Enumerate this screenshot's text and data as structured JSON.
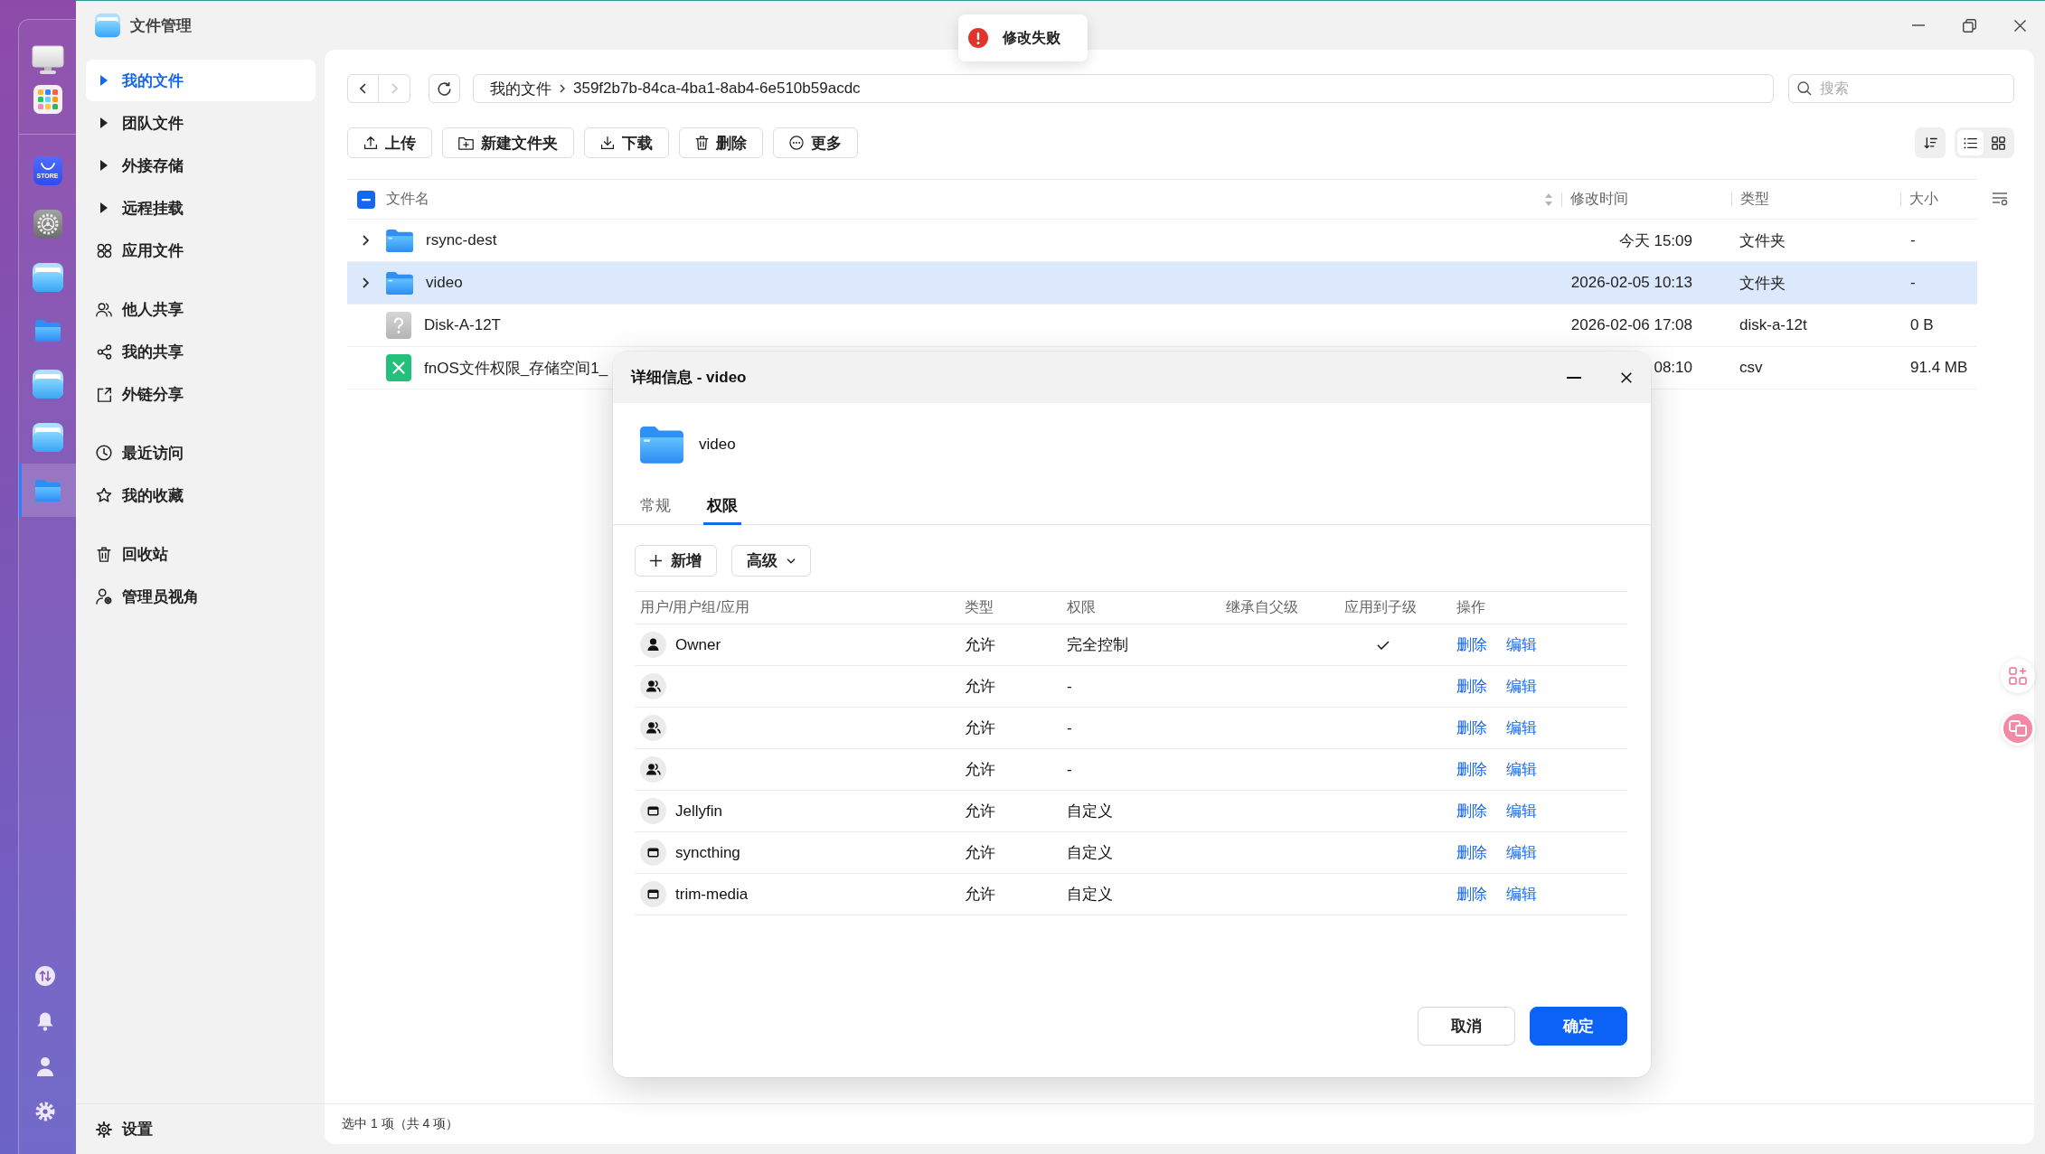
{
  "dock": {
    "groups": [
      {
        "items": [
          {
            "kind": "display",
            "selected": false
          },
          {
            "kind": "launcher",
            "selected": false
          }
        ]
      },
      {
        "items": [
          {
            "kind": "store",
            "label": "STORE",
            "selected": false
          },
          {
            "kind": "settings",
            "selected": false
          },
          {
            "kind": "files",
            "selected": false
          },
          {
            "kind": "folder",
            "selected": false
          },
          {
            "kind": "files",
            "selected": false
          },
          {
            "kind": "files",
            "selected": false
          },
          {
            "kind": "folder",
            "selected": true
          }
        ]
      }
    ]
  },
  "window": {
    "title": "文件管理"
  },
  "toast": {
    "kind": "error",
    "message": "修改失败"
  },
  "sidebar": {
    "groups": [
      {
        "items": [
          {
            "kind": "tree",
            "label": "我的文件",
            "expanded": false,
            "selected": true
          },
          {
            "kind": "tree",
            "label": "团队文件",
            "expanded": false,
            "selected": false
          },
          {
            "kind": "tree",
            "label": "外接存储",
            "expanded": false,
            "selected": false
          },
          {
            "kind": "tree",
            "label": "远程挂载",
            "expanded": false,
            "selected": false
          },
          {
            "kind": "link",
            "label": "应用文件",
            "selected": false
          }
        ]
      },
      {
        "items": [
          {
            "kind": "link",
            "label": "他人共享",
            "selected": false
          },
          {
            "kind": "link",
            "label": "我的共享",
            "selected": false
          },
          {
            "kind": "link",
            "label": "外链分享",
            "selected": false
          }
        ]
      },
      {
        "items": [
          {
            "kind": "link",
            "label": "最近访问",
            "selected": false
          },
          {
            "kind": "link",
            "label": "我的收藏",
            "selected": false
          }
        ]
      },
      {
        "items": [
          {
            "kind": "link",
            "label": "回收站",
            "selected": false
          },
          {
            "kind": "link",
            "label": "管理员视角",
            "selected": false
          }
        ]
      }
    ],
    "footer": {
      "label": "设置"
    }
  },
  "navigation": {
    "back": {
      "disabled": false
    },
    "forward": {
      "disabled": true
    },
    "path": [
      "我的文件",
      "359f2b7b-84ca-4ba1-8ab4-6e510b59acdc"
    ]
  },
  "search": {
    "placeholder": "搜索"
  },
  "toolbar": {
    "buttons": [
      {
        "label": "上传"
      },
      {
        "label": "新建文件夹"
      },
      {
        "label": "下载"
      },
      {
        "label": "删除"
      },
      {
        "label": "更多"
      }
    ],
    "views": [
      {
        "kind": "list",
        "selected": true
      },
      {
        "kind": "grid",
        "selected": false
      }
    ]
  },
  "file_table": {
    "select_all": {
      "indeterminate": true
    },
    "columns": [
      "文件名",
      "修改时间",
      "类型",
      "大小"
    ],
    "rows": [
      {
        "kind": "folder",
        "name": "rsync-dest",
        "modified": "今天 15:09",
        "type": "文件夹",
        "size": "-",
        "expanded": false,
        "selected": false
      },
      {
        "kind": "folder",
        "name": "video",
        "modified": "2026-02-05 10:13",
        "type": "文件夹",
        "size": "-",
        "expanded": false,
        "selected": true
      },
      {
        "kind": "disk",
        "name": "Disk-A-12T",
        "modified": "2026-02-06 17:08",
        "type": "disk-a-12t",
        "size": "0 B",
        "selected": false
      },
      {
        "kind": "spreadsheet",
        "name": "fnOS文件权限_存储空间1_",
        "modified": "08:10",
        "type": "csv",
        "size": "91.4 MB",
        "selected": false
      }
    ]
  },
  "status_bar": {
    "text": "选中 1 项（共 4 项）"
  },
  "dialog": {
    "title": "详细信息 - video",
    "item_name": "video",
    "tabs": [
      {
        "label": "常规",
        "selected": false
      },
      {
        "label": "权限",
        "selected": true
      }
    ],
    "actions": [
      {
        "kind": "add",
        "label": "新增"
      },
      {
        "kind": "dropdown",
        "label": "高级"
      }
    ],
    "columns": [
      "用户/用户组/应用",
      "类型",
      "权限",
      "继承自父级",
      "应用到子级",
      "操作"
    ],
    "entries": [
      {
        "kind": "user",
        "name": "Owner",
        "type": "允许",
        "permission": "完全控制",
        "apply_to_children": true,
        "operations": [
          "删除",
          "编辑"
        ]
      },
      {
        "kind": "group",
        "type": "允许",
        "permission": "-",
        "apply_to_children": false,
        "operations": [
          "删除",
          "编辑"
        ]
      },
      {
        "kind": "group",
        "type": "允许",
        "permission": "-",
        "apply_to_children": false,
        "operations": [
          "删除",
          "编辑"
        ]
      },
      {
        "kind": "group",
        "type": "允许",
        "permission": "-",
        "apply_to_children": false,
        "operations": [
          "删除",
          "编辑"
        ]
      },
      {
        "kind": "app",
        "name": "Jellyfin",
        "type": "允许",
        "permission": "自定义",
        "apply_to_children": false,
        "operations": [
          "删除",
          "编辑"
        ]
      },
      {
        "kind": "app",
        "name": "syncthing",
        "type": "允许",
        "permission": "自定义",
        "apply_to_children": false,
        "operations": [
          "删除",
          "编辑"
        ]
      },
      {
        "kind": "app",
        "name": "trim-media",
        "type": "允许",
        "permission": "自定义",
        "apply_to_children": false,
        "operations": [
          "删除",
          "编辑"
        ]
      }
    ],
    "buttons": [
      {
        "kind": "secondary",
        "label": "取消"
      },
      {
        "kind": "primary",
        "label": "确定"
      }
    ]
  }
}
